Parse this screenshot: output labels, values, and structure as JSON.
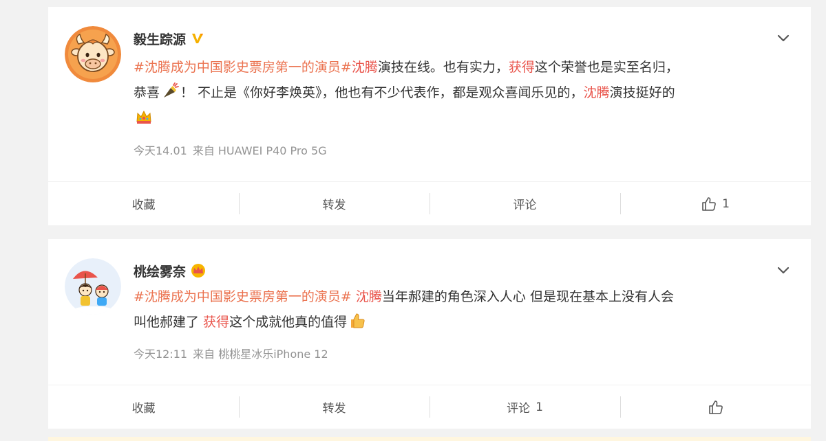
{
  "posts": [
    {
      "username": "毅生踪源",
      "badge_icon": "verified-v-icon",
      "content": {
        "line1": {
          "topic": "#沈腾成为中国影史票房第一的演员#",
          "keyword1": "沈腾",
          "text1": "演技在线。也有实力，",
          "keyword2": "获得",
          "text2": "这个荣誉也是实至名归，"
        },
        "line2": {
          "text1": "恭喜",
          "emoji": "firecracker-emoji",
          "text2": "！ 不止是《你好李焕英》，他也有不少代表作，都是观众喜闻乐见的，",
          "keyword": "沈腾",
          "text3": "演技挺好的"
        },
        "line3": {
          "emoji": "crown-emoji"
        }
      },
      "time": "今天14.01",
      "source": "来自 HUAWEI P40 Pro 5G",
      "actions": {
        "collect": "收藏",
        "repost": "转发",
        "comment": "评论",
        "comment_count": "",
        "like_count": "1"
      }
    },
    {
      "username": "桃绘雾奈",
      "badge_icon": "crown-badge-icon",
      "content": {
        "line1": {
          "topic": "#沈腾成为中国影史票房第一的演员#",
          "keyword1": "沈腾",
          "text1": "当年郝建的角色深入人心 但是现在基本上没有人会"
        },
        "line2": {
          "text1": "叫他郝建了 ",
          "keyword": "获得",
          "text2": "这个成就他真的值得",
          "emoji": "thumbs-up-emoji"
        }
      },
      "time": "今天12:11",
      "source": "来自 桃桃星冰乐iPhone 12",
      "actions": {
        "collect": "收藏",
        "repost": "转发",
        "comment": "评论",
        "comment_count": "1",
        "like_count": ""
      }
    }
  ],
  "colors": {
    "topic": "#eb7350",
    "keyword": "#e9544b",
    "meta": "#939393",
    "background": "#f2f2f2"
  }
}
